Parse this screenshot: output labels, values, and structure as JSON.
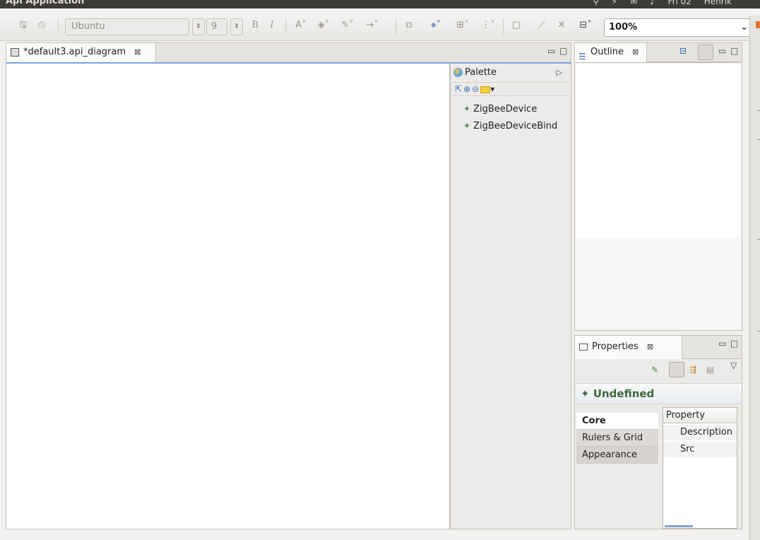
{
  "window": {
    "title": "Api Application",
    "tray": [
      "⚲",
      "⚡",
      "✉",
      "♪",
      "Fri 02",
      "Henrik"
    ]
  },
  "toolbar": {
    "font_family": "Ubuntu",
    "font_size": "9",
    "bold": "B",
    "italic": "I",
    "zoom_value": "100%"
  },
  "editor": {
    "tab_title": "*default3.api_diagram",
    "close_glyph": "⊠"
  },
  "palette": {
    "title": "Palette",
    "items": [
      {
        "label": "ZigBeeDevice"
      },
      {
        "label": "ZigBeeDeviceBind"
      }
    ]
  },
  "outline": {
    "title": "Outline"
  },
  "properties": {
    "title": "Properties",
    "selection": "Undefined",
    "categories": {
      "core": "Core",
      "rulers": "Rulers & Grid",
      "appearance": "Appearance"
    },
    "table": {
      "header": "Property",
      "rows": [
        "Description",
        "Src"
      ]
    }
  },
  "icons": {
    "save": "save-icon",
    "print": "print-icon",
    "diamond": "diamond-icon"
  },
  "colors": {
    "accent_blue": "#7ea4d9",
    "undefined_green": "#3f6a3e"
  }
}
